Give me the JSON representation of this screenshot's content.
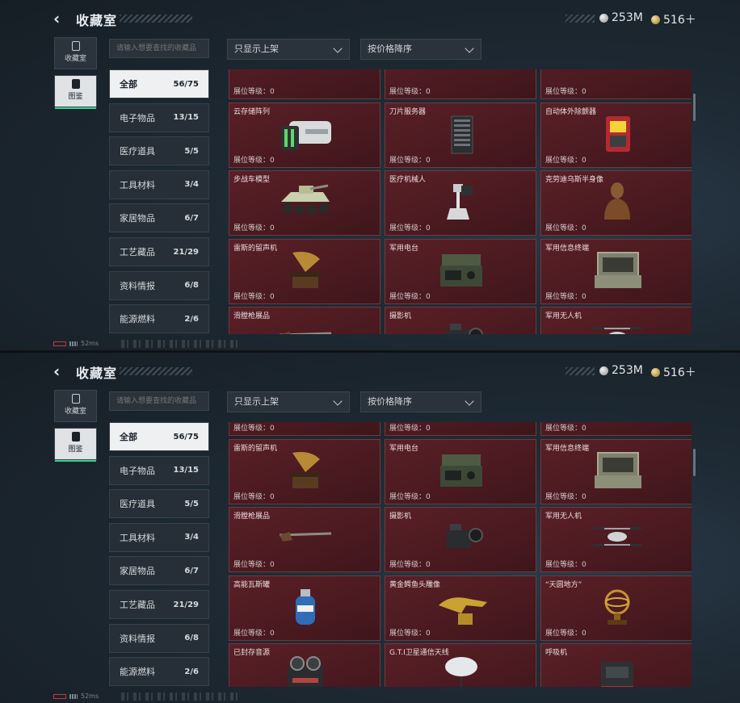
{
  "header": {
    "title": "收藏室",
    "silver": "253M",
    "gold": "516＋"
  },
  "nav": [
    {
      "label": "收藏室",
      "icon": "archive-icon"
    },
    {
      "label": "图鉴",
      "icon": "gallery-icon",
      "active": true
    }
  ],
  "search": {
    "placeholder": "请输入想要查找的收藏品"
  },
  "filters": {
    "display": "只显示上架",
    "sort": "按价格降序"
  },
  "categories": [
    {
      "label": "全部",
      "count": "56/75",
      "active": true
    },
    {
      "label": "电子物品",
      "count": "13/15"
    },
    {
      "label": "医疗道具",
      "count": "5/5"
    },
    {
      "label": "工具材料",
      "count": "3/4"
    },
    {
      "label": "家居物品",
      "count": "6/7"
    },
    {
      "label": "工艺藏品",
      "count": "21/29"
    },
    {
      "label": "资料情报",
      "count": "6/8"
    },
    {
      "label": "能源燃料",
      "count": "2/6"
    }
  ],
  "level_prefix": "展位等级：0",
  "status": {
    "ping": "52ms"
  },
  "screen1_items": [
    {
      "name": "",
      "icon": "crate-icon"
    },
    {
      "name": "",
      "icon": "tool-icon"
    },
    {
      "name": "",
      "icon": "rifle-icon"
    },
    {
      "name": "云存储阵列",
      "icon": "storage-array-icon"
    },
    {
      "name": "刀片服务器",
      "icon": "server-icon"
    },
    {
      "name": "自动体外除颤器",
      "icon": "defibrillator-icon"
    },
    {
      "name": "步战车模型",
      "icon": "armored-vehicle-icon"
    },
    {
      "name": "医疗机械人",
      "icon": "medical-robot-icon"
    },
    {
      "name": "克劳迪乌斯半身像",
      "icon": "bust-icon"
    },
    {
      "name": "雷斯的留声机",
      "icon": "gramophone-icon"
    },
    {
      "name": "军用电台",
      "icon": "radio-icon"
    },
    {
      "name": "军用信息终端",
      "icon": "terminal-icon"
    },
    {
      "name": "滑膛枪展品",
      "icon": "musket-icon"
    },
    {
      "name": "摄影机",
      "icon": "camera-icon"
    },
    {
      "name": "军用无人机",
      "icon": "drone-icon"
    }
  ],
  "screen2_items": [
    {
      "name": "",
      "icon": "blank-icon"
    },
    {
      "name": "",
      "icon": "blank-icon"
    },
    {
      "name": "",
      "icon": "blank-icon"
    },
    {
      "name": "雷斯的留声机",
      "icon": "gramophone-icon"
    },
    {
      "name": "军用电台",
      "icon": "radio-icon"
    },
    {
      "name": "军用信息终端",
      "icon": "terminal-icon"
    },
    {
      "name": "滑膛枪展品",
      "icon": "musket-icon"
    },
    {
      "name": "摄影机",
      "icon": "camera-icon"
    },
    {
      "name": "军用无人机",
      "icon": "drone-icon"
    },
    {
      "name": "高能瓦斯罐",
      "icon": "gas-tank-icon"
    },
    {
      "name": "黄金鳄鱼头雕像",
      "icon": "gold-crocodile-icon"
    },
    {
      "name": "“天圆地方”",
      "icon": "armillary-icon"
    },
    {
      "name": "已封存音源",
      "icon": "reel-recorder-icon"
    },
    {
      "name": "G.T.I卫星通信天线",
      "icon": "satellite-dish-icon"
    },
    {
      "name": "呼吸机",
      "icon": "ventilator-icon"
    }
  ]
}
